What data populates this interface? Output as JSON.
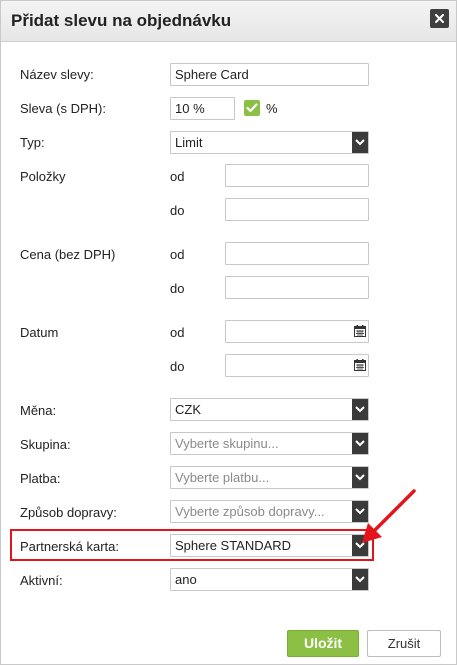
{
  "dialog": {
    "title": "Přidat slevu na objednávku",
    "close_icon": "close-icon"
  },
  "form": {
    "name": {
      "label": "Název slevy:",
      "value": "Sphere Card"
    },
    "discount": {
      "label": "Sleva (s DPH):",
      "value": "10 %",
      "checkbox_checked": true,
      "checkbox_label": "%"
    },
    "type": {
      "label": "Typ:",
      "value": "Limit"
    },
    "items": {
      "label": "Položky",
      "from_label": "od",
      "to_label": "do",
      "from_value": "",
      "to_value": ""
    },
    "price": {
      "label": "Cena (bez DPH)",
      "from_label": "od",
      "to_label": "do",
      "from_value": "",
      "to_value": ""
    },
    "date": {
      "label": "Datum",
      "from_label": "od",
      "to_label": "do",
      "from_value": "",
      "to_value": "",
      "icon": "calendar-icon"
    },
    "currency": {
      "label": "Měna:",
      "value": "CZK"
    },
    "group": {
      "label": "Skupina:",
      "placeholder": "Vyberte skupinu..."
    },
    "payment": {
      "label": "Platba:",
      "placeholder": "Vyberte platbu..."
    },
    "shipping": {
      "label": "Způsob dopravy:",
      "placeholder": "Vyberte způsob dopravy..."
    },
    "partner_card": {
      "label": "Partnerská karta:",
      "value": "Sphere STANDARD"
    },
    "active": {
      "label": "Aktivní:",
      "value": "ano"
    }
  },
  "annotation": {
    "highlight_color": "#e3141b"
  },
  "colors": {
    "accent": "#8bc045",
    "dropdown_arrow_bg": "#3a3a3a"
  },
  "buttons": {
    "save": "Uložit",
    "cancel": "Zrušit"
  }
}
